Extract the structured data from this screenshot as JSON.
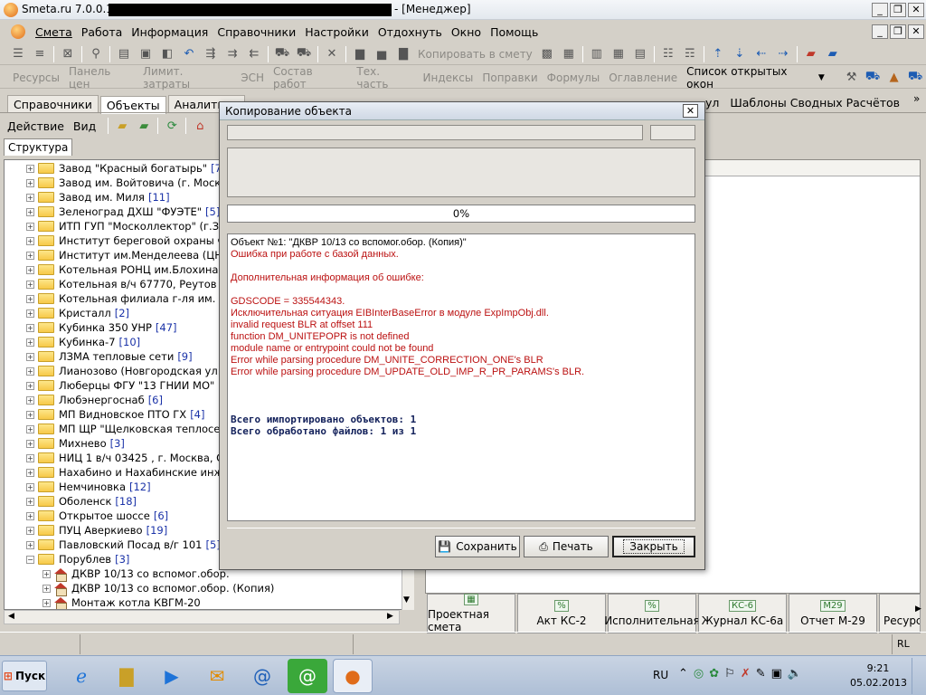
{
  "window": {
    "app_title": "Smeta.ru  7.0.0.16",
    "role": "- [Менеджер]"
  },
  "menu": [
    "Смета",
    "Работа",
    "Информация",
    "Справочники",
    "Настройки",
    "Отдохнуть",
    "Окно",
    "Помощь"
  ],
  "toolbar1": {
    "copy_to_estimate": "Копировать в смету"
  },
  "toolbar2": {
    "items": [
      "Ресурсы",
      "Панель цен",
      "Лимит. затраты",
      "ЭСН",
      "Состав работ",
      "Тех. часть",
      "Индексы",
      "Поправки",
      "Формулы",
      "Оглавление"
    ],
    "open_windows": "Список открытых окон"
  },
  "tabs_left": [
    "Справочники",
    "Объекты",
    "Аналитика"
  ],
  "tabs_right": {
    "partial": "ул",
    "templates": "Шаблоны Сводных Расчётов"
  },
  "toolbar3": {
    "action": "Действие",
    "view": "Вид"
  },
  "structure_tab": "Структура",
  "tree": [
    {
      "label": "Завод \"Красный богатырь\"",
      "count": "[7]"
    },
    {
      "label": "Завод им. Войтовича (г. Москва)",
      "count": ""
    },
    {
      "label": "Завод им. Миля",
      "count": "[11]"
    },
    {
      "label": "Зеленоград ДХШ \"ФУЭТЕ\"",
      "count": "[5]"
    },
    {
      "label": "ИТП  ГУП \"Москоллектор\" (г.Зел",
      "count": ""
    },
    {
      "label": "Институт береговой охраны ФСБ",
      "count": ""
    },
    {
      "label": "Институт им.Менделеева (ЦНИИХ",
      "count": ""
    },
    {
      "label": "Котельная  РОНЦ им.Блохина РАН",
      "count": ""
    },
    {
      "label": "Котельная в/ч 67770, Реутов  Кот.",
      "count": ""
    },
    {
      "label": "Котельная филиала г-ля им. Манд",
      "count": ""
    },
    {
      "label": "Кристалл",
      "count": "[2]"
    },
    {
      "label": "Кубинка 350 УНР",
      "count": "[47]"
    },
    {
      "label": "Кубинка-7",
      "count": "[10]"
    },
    {
      "label": "ЛЗМА тепловые сети",
      "count": "[9]"
    },
    {
      "label": "Лианозово (Новгородская ул., вл.",
      "count": ""
    },
    {
      "label": "Люберцы  ФГУ \"13 ГНИИ МО\"",
      "count": "[9"
    },
    {
      "label": "Любэнергоснаб",
      "count": "[6]"
    },
    {
      "label": "МП Видновское ПТО ГХ",
      "count": "[4]"
    },
    {
      "label": "МП ЩР \"Щелковская теплосеть\"",
      "count": ""
    },
    {
      "label": "Михнево",
      "count": "[3]"
    },
    {
      "label": "НИЦ 1 в/ч 03425 , г. Москва, Оста",
      "count": ""
    },
    {
      "label": "Нахабино и Нахабинские инженер",
      "count": ""
    },
    {
      "label": "Немчиновка",
      "count": "[12]"
    },
    {
      "label": "Оболенск",
      "count": "[18]"
    },
    {
      "label": "Открытое шоссе",
      "count": "[6]"
    },
    {
      "label": "ПУЦ Аверкиево",
      "count": "[19]"
    },
    {
      "label": "Павловский Посад в/г 101",
      "count": "[5]"
    },
    {
      "label": "Порублев",
      "count": "[3]"
    }
  ],
  "tree_children": [
    "ДКВР 10/13 со вспомог.обор.",
    "ДКВР 10/13 со вспомог.обор. (Копия)",
    "Монтаж котла КВГМ-20"
  ],
  "dialog": {
    "title": "Копирование объекта",
    "progress": "0%",
    "progress_value": 0,
    "log": {
      "object": "Объект №1: \"ДКВР 10/13 со вспомог.обор. (Копия)\"",
      "error_db": "Ошибка при работе с базой данных.",
      "extra_info": "Дополнительная информация об ошибке:",
      "details": [
        "GDSCODE = 335544343.",
        "Исключительная ситуация EIBInterBaseError в модуле ExpImpObj.dll.",
        "invalid request BLR at offset 111",
        "function DM_UNITEPOPR is not defined",
        "module name or entrypoint could not be found",
        "Error while parsing procedure DM_UNITE_CORRECTION_ONE's BLR",
        "Error while parsing procedure DM_UPDATE_OLD_IMP_R_PR_PARAMS's BLR."
      ],
      "summary_imported": "Всего импортировано объектов: 1",
      "summary_files": "Всего обработано файлов: 1 из 1"
    },
    "buttons": {
      "save": "Сохранить",
      "print": "Печать",
      "close": "Закрыть"
    }
  },
  "bottom_tabs": [
    {
      "icon": "",
      "label": "Проектная смета"
    },
    {
      "icon": "%",
      "label": "Акт КС-2"
    },
    {
      "icon": "",
      "label": "Исполнительная"
    },
    {
      "icon": "КС-6",
      "label": "Журнал КС-6а"
    },
    {
      "icon": "М29",
      "label": "Отчет М-29"
    },
    {
      "icon": "",
      "label": "Ресурс"
    }
  ],
  "statusbar": {
    "right": "RL"
  },
  "taskbar": {
    "start": "Пуск",
    "lang": "RU",
    "time": "9:21",
    "date": "05.02.2013"
  },
  "colors": {
    "error": "#bb1111",
    "summary": "#12205a",
    "count": "#1b33a8"
  }
}
